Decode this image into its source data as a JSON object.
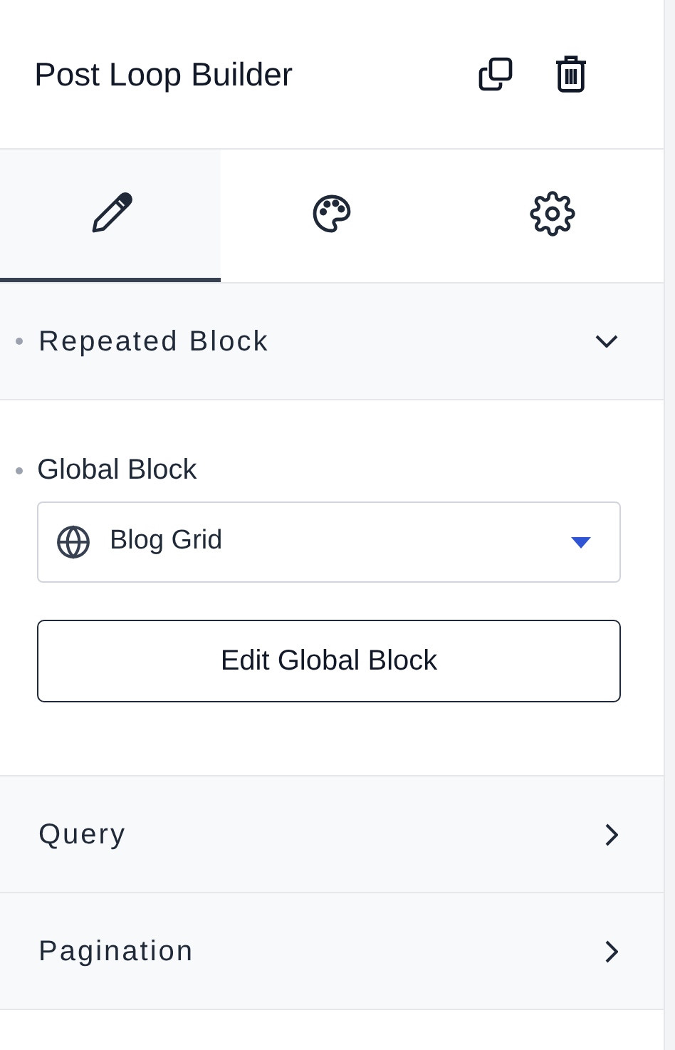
{
  "header": {
    "title": "Post Loop Builder"
  },
  "tabs": [
    {
      "kind": "pencil",
      "selected": true
    },
    {
      "kind": "palette",
      "selected": false
    },
    {
      "kind": "gear",
      "selected": false
    }
  ],
  "sections": [
    {
      "title": "Repeated Block",
      "modified": true,
      "expanded": true,
      "field": {
        "label": "Global Block",
        "modified": true,
        "value": "Blog Grid"
      },
      "button": "Edit Global Block"
    },
    {
      "title": "Query",
      "modified": false,
      "expanded": false
    },
    {
      "title": "Pagination",
      "modified": false,
      "expanded": false
    }
  ]
}
